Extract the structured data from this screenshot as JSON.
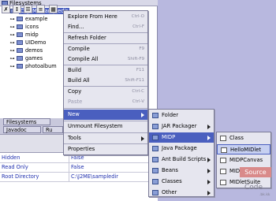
{
  "tree": {
    "title": "Filesystems",
    "root": "C:\\J2ME\\sampledir",
    "children": [
      "example",
      "icons",
      "midp",
      "UIDemo",
      "demos",
      "games",
      "photoalbum"
    ]
  },
  "tabs": {
    "filesystems": "Filesystems",
    "javadoc": "Javadoc",
    "runtime": "Ru"
  },
  "properties": [
    {
      "key": "Hidden",
      "value": "False"
    },
    {
      "key": "Read Only",
      "value": "False"
    },
    {
      "key": "Root Directory",
      "value": "C:\\J2ME\\sampledir"
    }
  ],
  "context_menu": [
    {
      "label": "Explore From Here",
      "shortcut": "Ctrl-O"
    },
    {
      "label": "Find...",
      "shortcut": "Ctrl-F"
    },
    {
      "label": "Refresh Folder",
      "shortcut": ""
    },
    {
      "label": "Compile",
      "shortcut": "F9"
    },
    {
      "label": "Compile All",
      "shortcut": "Shift-F9"
    },
    {
      "label": "Build",
      "shortcut": "F11"
    },
    {
      "label": "Build All",
      "shortcut": "Shift-F11"
    },
    {
      "label": "Copy",
      "shortcut": "Ctrl-C"
    },
    {
      "label": "Paste",
      "shortcut": "Ctrl-V"
    },
    {
      "label": "New",
      "shortcut": ""
    },
    {
      "label": "Unmount Filesystem",
      "shortcut": ""
    },
    {
      "label": "Tools",
      "shortcut": ""
    },
    {
      "label": "Properties",
      "shortcut": ""
    }
  ],
  "new_submenu": [
    "Folder",
    "JAR Packager",
    "MIDP",
    "Java Package",
    "Ant Build Scripts",
    "Beans",
    "Classes",
    "Other"
  ],
  "midp_submenu": [
    "Class",
    "HelloMIDlet",
    "MIDPCanvas",
    "MIDlet",
    "MIDletSuite"
  ],
  "watermark": {
    "top": "Source",
    "bottom": "Code",
    "small": ".bk.kk"
  }
}
